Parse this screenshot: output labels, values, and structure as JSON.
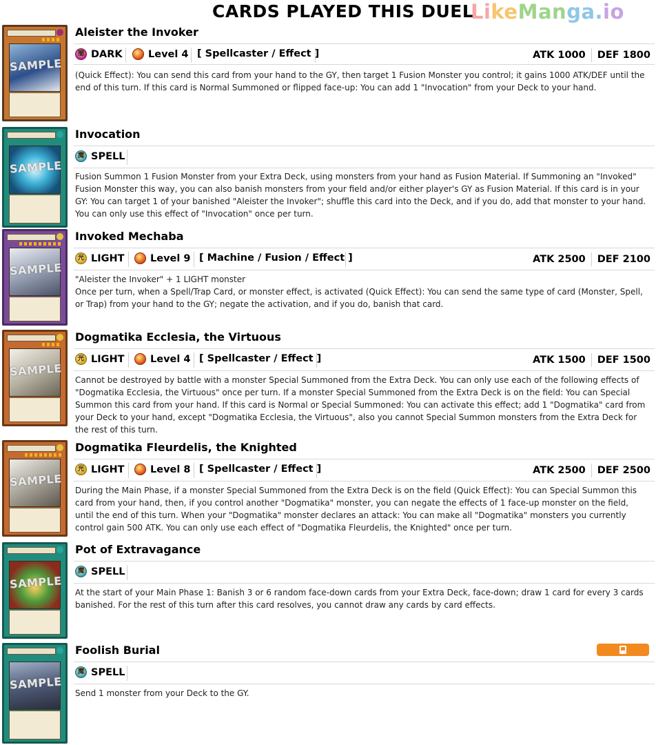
{
  "header": {
    "title": "CARDS PLAYED THIS DUEL",
    "watermark": [
      "Li",
      "ke",
      "Man",
      "ga.",
      "io"
    ]
  },
  "cards": [
    {
      "name": "Aleister the Invoker",
      "thumb_title": "Aleister the Invoker",
      "attribute": "DARK",
      "level": "Level 4",
      "type": "[ Spellcaster / Effect ]",
      "atk": "ATK 1000",
      "def": "DEF 1800",
      "description": "(Quick Effect): You can send this card from your hand to the GY, then target 1 Fusion Monster you control; it gains 1000 ATK/DEF until the end of this turn. If this card is Normal Summoned or flipped face-up: You can add 1 \"Invocation\" from your Deck to your hand."
    },
    {
      "name": "Invocation",
      "thumb_title": "Invocation",
      "attribute": "SPELL",
      "description": "Fusion Summon 1 Fusion Monster from your Extra Deck, using monsters from your hand as Fusion Material. If Summoning an \"Invoked\" Fusion Monster this way, you can also banish monsters from your field and/or either player's GY as Fusion Material. If this card is in your GY: You can target 1 of your banished \"Aleister the Invoker\"; shuffle this card into the Deck, and if you do, add that monster to your hand. You can only use this effect of \"Invocation\" once per turn."
    },
    {
      "name": "Invoked Mechaba",
      "thumb_title": "Invoked Mechaba",
      "attribute": "LIGHT",
      "level": "Level 9",
      "type": "[ Machine / Fusion / Effect ]",
      "atk": "ATK 2500",
      "def": "DEF 2100",
      "description_line1": "\"Aleister the Invoker\" + 1 LIGHT monster",
      "description": "Once per turn, when a Spell/Trap Card, or monster effect, is activated (Quick Effect): You can send the same type of card (Monster, Spell, or Trap) from your hand to the GY; negate the activation, and if you do, banish that card."
    },
    {
      "name": "Dogmatika Ecclesia, the Virtuous",
      "thumb_title": "Dogmatika Ecclesia, the Virtuous",
      "attribute": "LIGHT",
      "level": "Level 4",
      "type": "[ Spellcaster / Effect ]",
      "atk": "ATK 1500",
      "def": "DEF 1500",
      "description": "Cannot be destroyed by battle with a monster Special Summoned from the Extra Deck. You can only use each of the following effects of \"Dogmatika Ecclesia, the Virtuous\" once per turn. If a monster Special Summoned from the Extra Deck is on the field: You can Special Summon this card from your hand. If this card is Normal or Special Summoned: You can activate this effect; add 1 \"Dogmatika\" card from your Deck to your hand, except \"Dogmatika Ecclesia, the Virtuous\", also you cannot Special Summon monsters from the Extra Deck for the rest of this turn."
    },
    {
      "name": "Dogmatika Fleurdelis, the Knighted",
      "thumb_title": "Dogmatika Fleurdelis, the Knighted",
      "attribute": "LIGHT",
      "level": "Level 8",
      "type": "[ Spellcaster / Effect ]",
      "atk": "ATK 2500",
      "def": "DEF 2500",
      "description": "During the Main Phase, if a monster Special Summoned from the Extra Deck is on the field (Quick Effect): You can Special Summon this card from your hand, then, if you control another \"Dogmatika\" monster, you can negate the effects of 1 face-up monster on the field, until the end of this turn. When your \"Dogmatika\" monster declares an attack: You can make all \"Dogmatika\" monsters you currently control gain 500 ATK. You can only use each effect of \"Dogmatika Fleurdelis, the Knighted\" once per turn."
    },
    {
      "name": "Pot of Extravagance",
      "thumb_title": "Pot of Extravagance",
      "attribute": "SPELL",
      "description": "At the start of your Main Phase 1: Banish 3 or 6 random face-down cards from your Extra Deck, face-down; draw 1 card for every 3 cards banished. For the rest of this turn after this card resolves, you cannot draw any cards by card effects."
    },
    {
      "name": "Foolish Burial",
      "thumb_title": "Foolish Burial",
      "attribute": "SPELL",
      "description": "Send 1 monster from your Deck to the GY."
    }
  ],
  "thumb_watermark": "SAMPLE",
  "colors": {
    "badge": "#f28a20",
    "normal_frame": "#c07a3b",
    "effect_frame": "#c56a30",
    "spell_frame": "#1f8c7e",
    "fusion_frame": "#7a4b9a"
  }
}
